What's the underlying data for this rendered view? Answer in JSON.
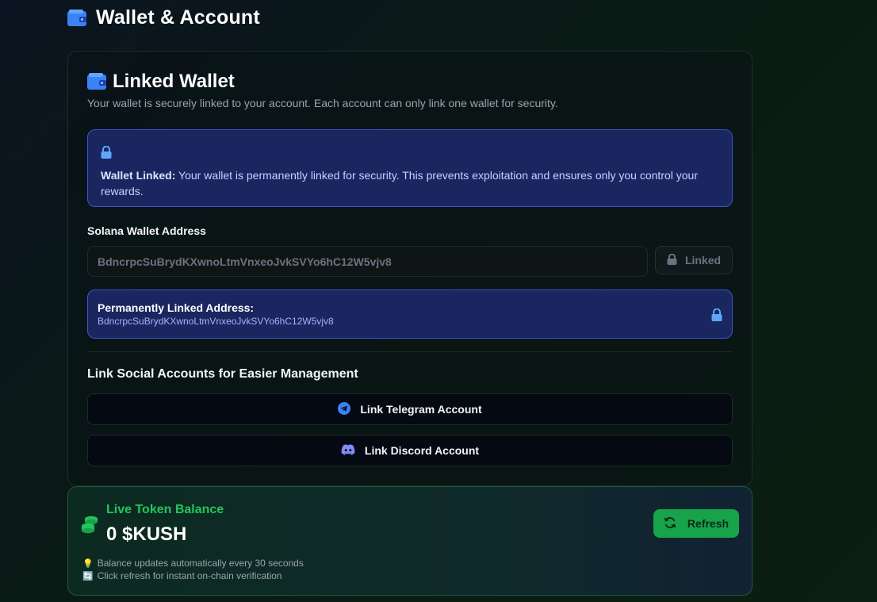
{
  "page": {
    "title": "Wallet & Account"
  },
  "linked_wallet": {
    "title": "Linked Wallet",
    "subtitle": "Your wallet is securely linked to your account. Each account can only link one wallet for security.",
    "notice": {
      "strong": "Wallet Linked:",
      "text": " Your wallet is permanently linked for security. This prevents exploitation and ensures only you control your rewards."
    },
    "address_label": "Solana Wallet Address",
    "address_value": "BdncrpcSuBrydKXwnoLtmVnxeoJvkSVYo6hC12W5vjv8",
    "linked_button": "Linked",
    "permanent": {
      "label": "Permanently Linked Address:",
      "address": "BdncrpcSuBrydKXwnoLtmVnxeoJvkSVYo6hC12W5vjv8"
    },
    "social_heading": "Link Social Accounts for Easier Management",
    "telegram_button": "Link Telegram Account",
    "discord_button": "Link Discord Account"
  },
  "balance": {
    "title": "Live Token Balance",
    "value": "0 $KUSH",
    "refresh_button": "Refresh",
    "hint1_emoji": "💡",
    "hint1": "Balance updates automatically every 30 seconds",
    "hint2_emoji": "🔄",
    "hint2": "Click refresh for instant on-chain verification"
  },
  "colors": {
    "accent_blue": "#3b82f6",
    "accent_green": "#22c55e",
    "notice_bg": "#1a2660",
    "discord": "#5865f2"
  },
  "icons": {
    "header": "wallet-icon",
    "card_title": "wallet-icon",
    "notice": "lock-icon",
    "linked": "lock-icon",
    "permanent": "lock-icon",
    "telegram": "telegram-icon",
    "discord": "discord-icon",
    "balance": "coins-icon",
    "refresh": "refresh-icon"
  }
}
